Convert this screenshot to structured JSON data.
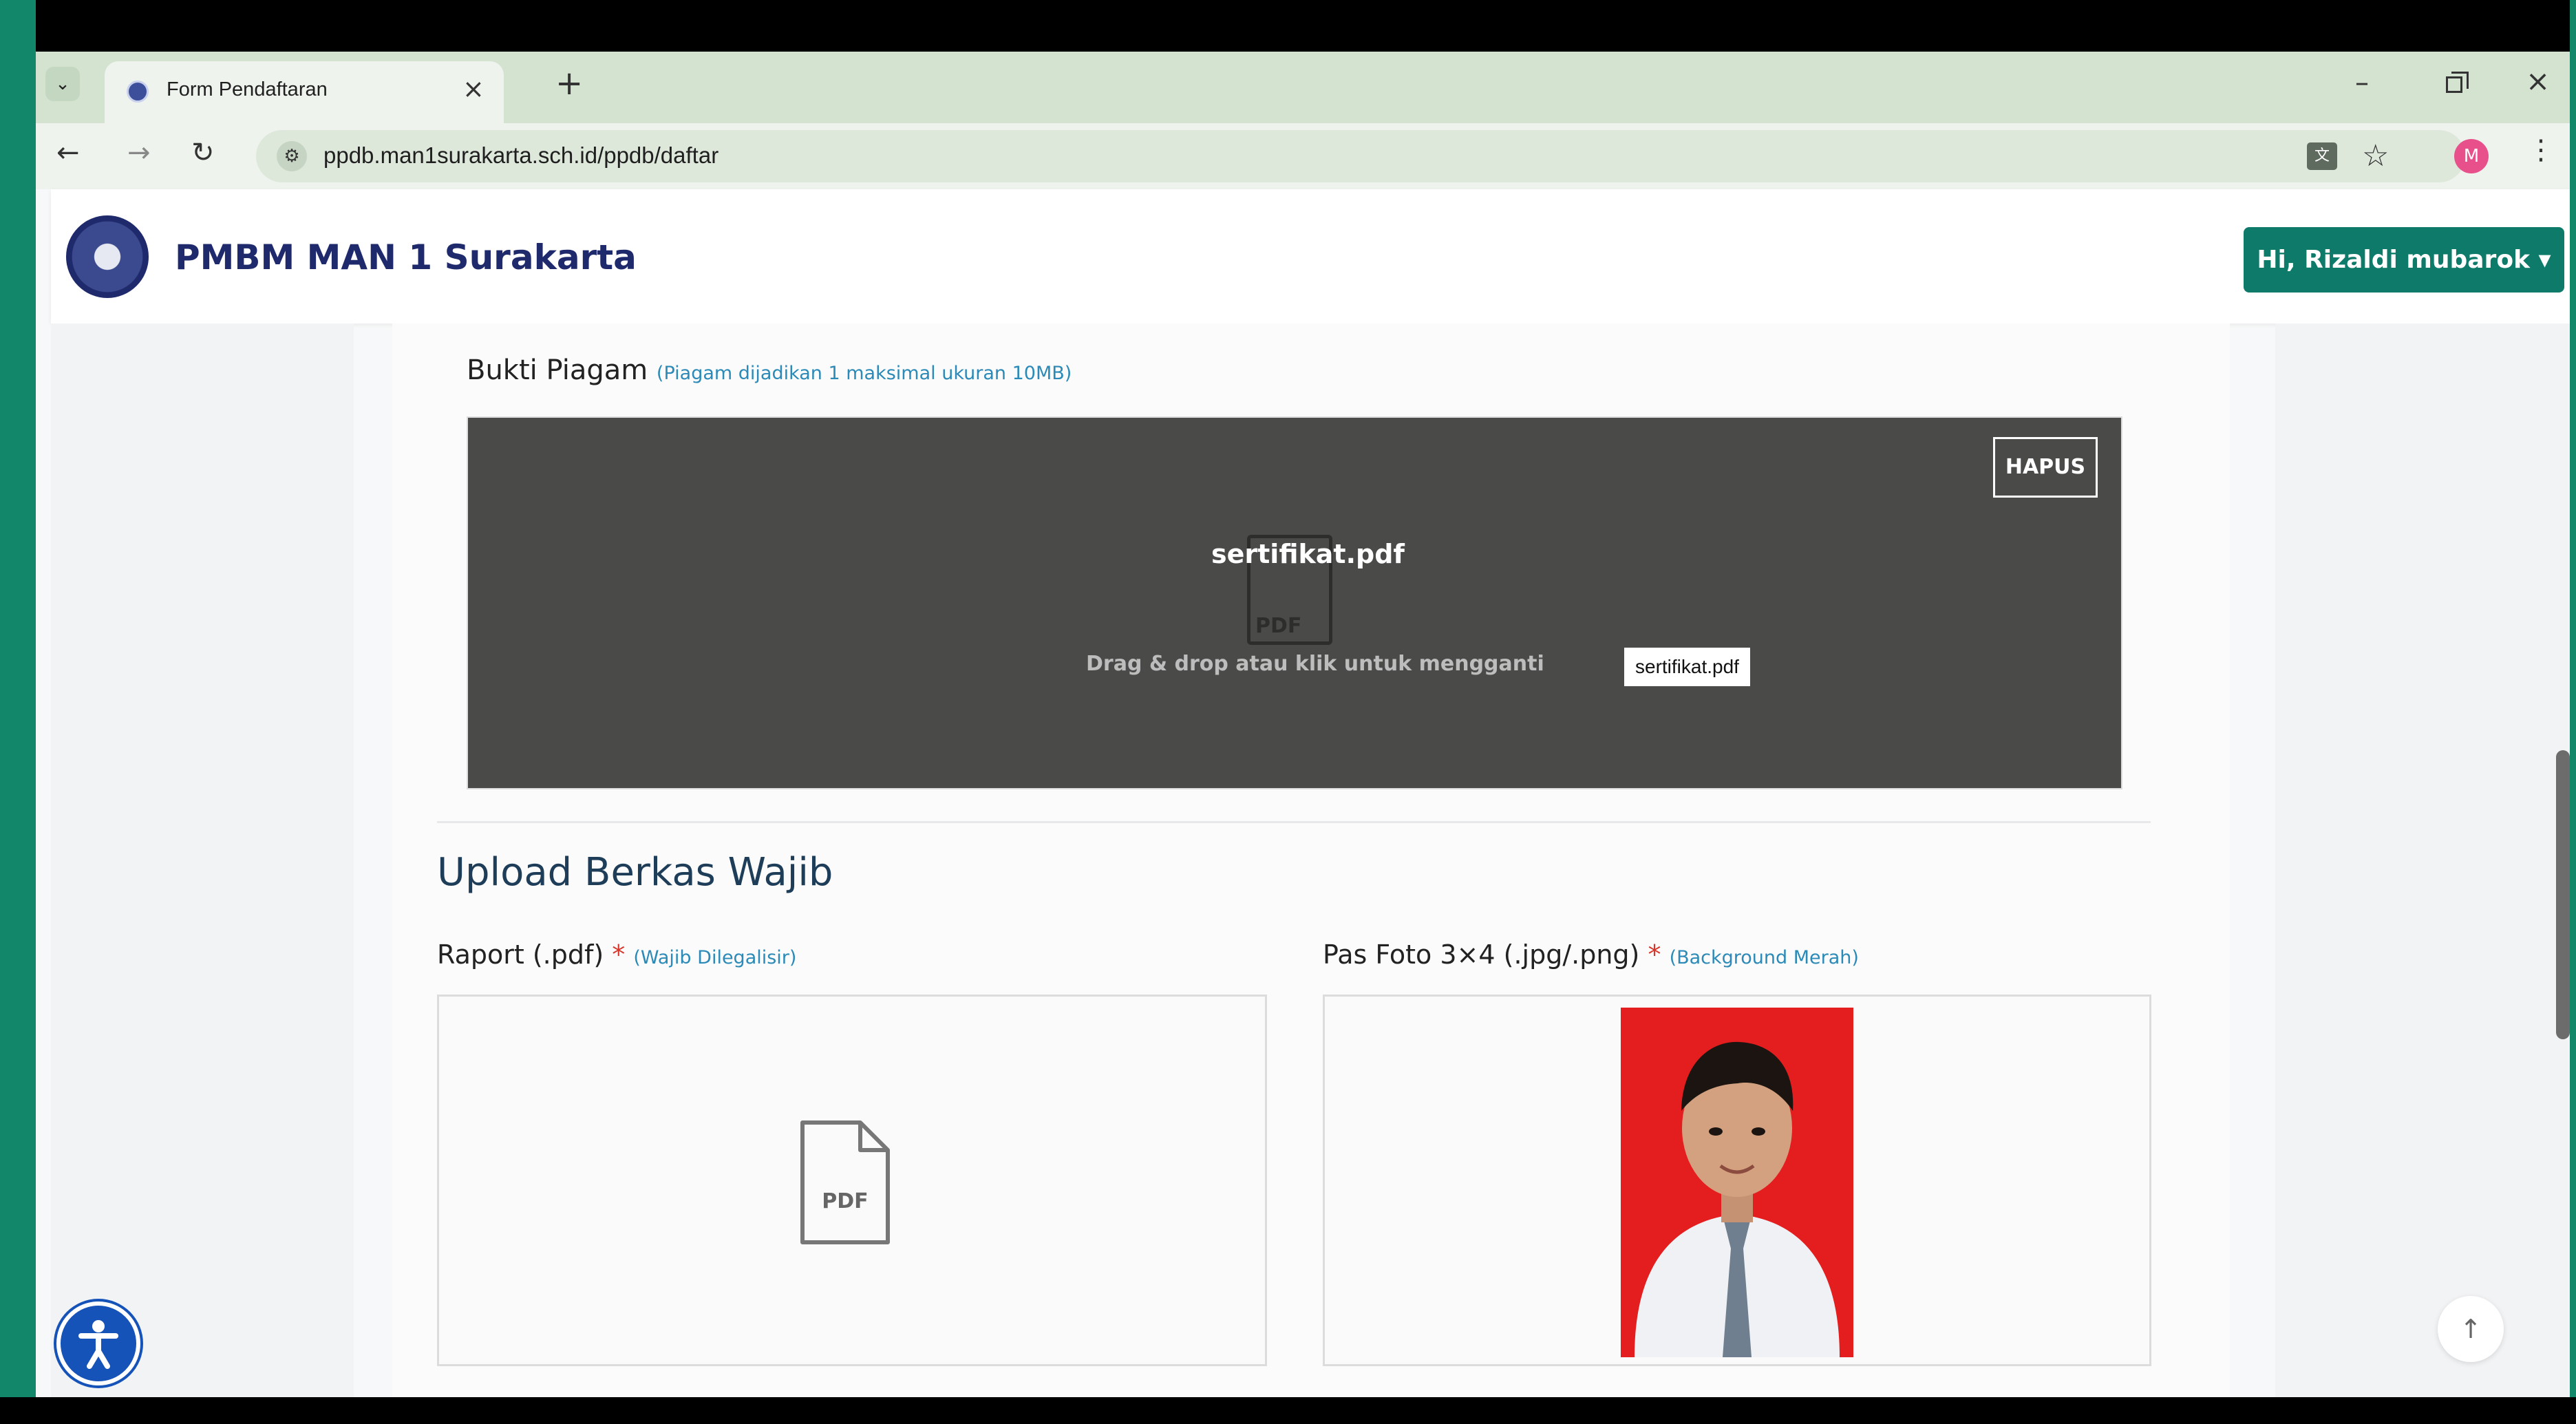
{
  "browser": {
    "tab_title": "Form Pendaftaran",
    "url": "ppdb.man1surakarta.sch.id/ppdb/daftar",
    "profile_initial": "M"
  },
  "header": {
    "brand": "PMBM MAN 1 Surakarta",
    "user_menu": "Hi, Rizaldi mubarok ▾"
  },
  "piagam": {
    "label": "Bukti Piagam",
    "note": "(Piagam dijadikan 1 maksimal ukuran 10MB)",
    "delete_button": "HAPUS",
    "file_name": "sertifikat.pdf",
    "drag_hint": "Drag & drop atau klik untuk mengganti",
    "tooltip": "sertifikat.pdf",
    "icon_text": "PDF"
  },
  "wajib": {
    "title": "Upload Berkas Wajib",
    "raport_label": "Raport (.pdf)",
    "raport_required": "*",
    "raport_note": "(Wajib Dilegalisir)",
    "raport_icon_text": "PDF",
    "foto_label": "Pas Foto 3×4 (.jpg/.png)",
    "foto_required": "*",
    "foto_note": "(Background Merah)"
  },
  "colors": {
    "accent": "#0e7a6a",
    "brand": "#1e2a6b",
    "required": "#d9362b",
    "note": "#2b8ab7",
    "photo_background": "#e41e1e"
  }
}
